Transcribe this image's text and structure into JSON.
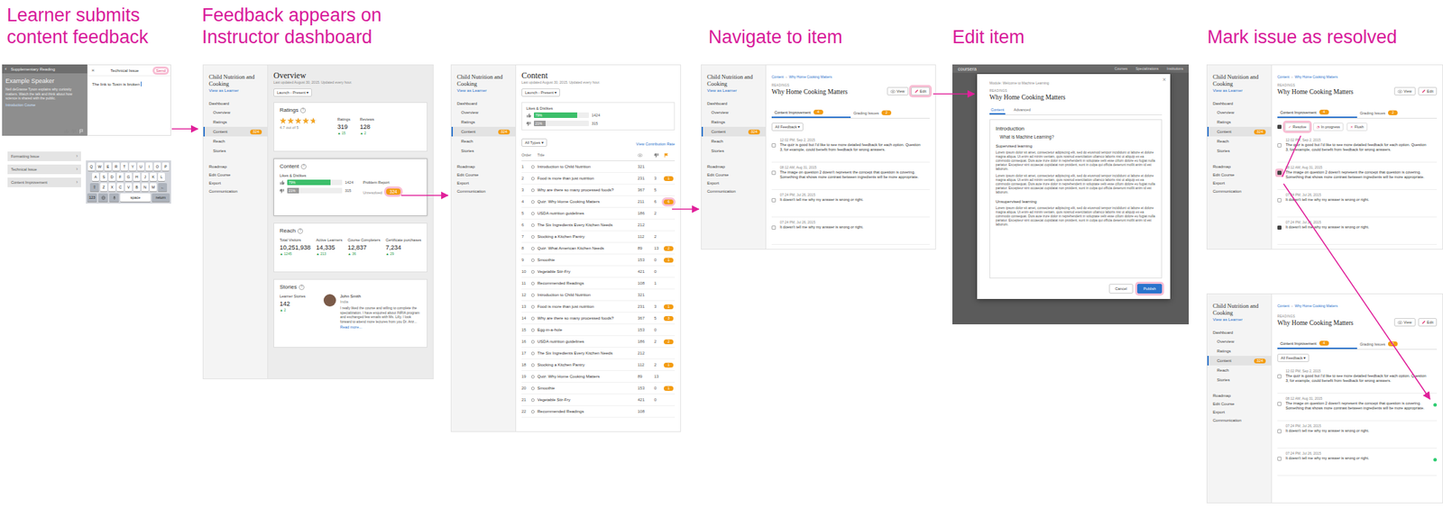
{
  "stepTitles": [
    "Learner submits content feedback",
    "Feedback appears on Instructor dashboard",
    "Navigate to item",
    "Edit item",
    "Mark issue as resolved"
  ],
  "mobile": {
    "reading": {
      "back": "‹",
      "title": "Supplementary Reading",
      "heading": "Example Speaker",
      "body": "Neil deGrasse Tyson explains why curiosity matters. Watch the talk and think about how science is shared with the public.",
      "link": "Introduction Course"
    },
    "report": {
      "close": "×",
      "title": "Technical Issue",
      "send": "Send",
      "sendHighlighted": true,
      "text": "The link to Tosin is broken"
    },
    "issueTypes": [
      {
        "label": "Formatting Issue",
        "chevron": "›"
      },
      {
        "label": "Technical Issue",
        "chevron": "›"
      },
      {
        "label": "Content Improvement",
        "chevron": "›"
      }
    ],
    "keyboard": {
      "rows": [
        [
          "Q",
          "W",
          "E",
          "R",
          "T",
          "Y",
          "U",
          "I",
          "O",
          "P"
        ],
        [
          "A",
          "S",
          "D",
          "F",
          "G",
          "H",
          "J",
          "K",
          "L"
        ],
        [
          "⇧",
          "Z",
          "X",
          "C",
          "V",
          "B",
          "N",
          "M",
          "←"
        ]
      ],
      "bottom": [
        "123",
        "space",
        "return"
      ]
    }
  },
  "sidebar": {
    "course": "Child Nutrition and Cooking",
    "viewAs": "View as Learner",
    "heading": "Dashboard",
    "items": [
      {
        "label": "Overview",
        "badge": "",
        "selected": false
      },
      {
        "label": "Ratings",
        "badge": "",
        "selected": false
      },
      {
        "label": "Content",
        "badge": "324",
        "selected": true
      },
      {
        "label": "Reach",
        "badge": "",
        "selected": false
      },
      {
        "label": "Stories",
        "badge": "",
        "selected": false
      }
    ],
    "links": [
      "Roadmap",
      "Edit Course",
      "Export",
      "Communication"
    ]
  },
  "overview": {
    "title": "Overview",
    "updated": "Last updated August 30, 2015. Updated every hour.",
    "range": "Launch - Present ▾",
    "help": "?",
    "ratings": {
      "title": "Ratings",
      "stars": 4.7,
      "caption": "4.7 out of 5",
      "stats": [
        {
          "label": "Ratings",
          "value": "319",
          "delta": "▲ 15"
        },
        {
          "label": "Reviews",
          "value": "128",
          "delta": "▲ 2"
        }
      ]
    },
    "content": {
      "title": "Content",
      "likesTitle": "Likes & Dislikes",
      "bars": [
        {
          "kind": "like",
          "pct": "79%",
          "level": 0.79,
          "count": "1424",
          "color": "#3cbf6a"
        },
        {
          "kind": "dislike",
          "pct": "21%",
          "level": 0.21,
          "count": "315",
          "color": "#9a9a9a"
        }
      ],
      "problemTitle": "Problem Report",
      "unresolvedLabel": "Unresolved",
      "unresolved": "324",
      "unresolvedHighlighted": true
    },
    "reach": {
      "title": "Reach",
      "stats": [
        {
          "label": "Total Visitors",
          "value": "10,251,938",
          "delta": "▲ 1245"
        },
        {
          "label": "Active Learners",
          "value": "14,335",
          "delta": "▲ 213"
        },
        {
          "label": "Course Completers",
          "value": "12,837",
          "delta": "▲ 36"
        },
        {
          "label": "Certificate purchases",
          "value": "7,234",
          "delta": "▲ 29"
        }
      ]
    },
    "stories": {
      "title": "Stories",
      "label": "Learner Stories",
      "count": "142",
      "delta": "▲ 2",
      "name": "John Smith",
      "country": "India",
      "quote": "I really liked the course and willing to complete the specialization. I have enquired about INRIA program and exchanged few emails with Ms. Lilly. I look forward to attend more lectures from you Dr. Ariz...",
      "more": "Read more..."
    }
  },
  "contentPage": {
    "title": "Content",
    "filter": "All Types ▾",
    "contributionLink": "View Contribution Rate",
    "columns": [
      "Order",
      "Title"
    ],
    "rows": [
      {
        "order": "1",
        "title": "Introduction to Child Nutrition",
        "views": "321",
        "count": "",
        "issues": "",
        "highlighted": false
      },
      {
        "order": "2",
        "title": "Food is more than just nutrition",
        "views": "231",
        "count": "3",
        "issues": "1",
        "highlighted": false
      },
      {
        "order": "3",
        "title": "Why are there so many processed foods?",
        "views": "367",
        "count": "5",
        "issues": "",
        "highlighted": false
      },
      {
        "order": "4",
        "title": "Quiz: Why Home Cooking Matters",
        "views": "211",
        "count": "6",
        "issues": "6",
        "highlighted": true
      },
      {
        "order": "5",
        "title": "USDA nutrition guidelines",
        "views": "186",
        "count": "2",
        "issues": "",
        "highlighted": false
      },
      {
        "order": "6",
        "title": "The Six Ingredients Every Kitchen Needs",
        "views": "212",
        "count": "",
        "issues": "",
        "highlighted": false
      },
      {
        "order": "7",
        "title": "Stocking a Kitchen Pantry",
        "views": "112",
        "count": "2",
        "issues": "",
        "highlighted": false
      },
      {
        "order": "8",
        "title": "Quiz: What American Kitchen Needs",
        "views": "89",
        "count": "13",
        "issues": "2",
        "highlighted": false
      },
      {
        "order": "9",
        "title": "Smoothie",
        "views": "153",
        "count": "0",
        "issues": "1",
        "highlighted": false
      },
      {
        "order": "10",
        "title": "Vegetable Stir-Fry",
        "views": "421",
        "count": "0",
        "issues": "",
        "highlighted": false
      },
      {
        "order": "11",
        "title": "Recommended Readings",
        "views": "108",
        "count": "1",
        "issues": "",
        "highlighted": false
      },
      {
        "order": "12",
        "title": "Introduction to Child Nutrition",
        "views": "321",
        "count": "",
        "issues": "",
        "highlighted": false
      },
      {
        "order": "13",
        "title": "Food is more than just nutrition",
        "views": "231",
        "count": "3",
        "issues": "1",
        "highlighted": false
      },
      {
        "order": "14",
        "title": "Why are there so many processed foods?",
        "views": "367",
        "count": "5",
        "issues": "3",
        "highlighted": false
      },
      {
        "order": "15",
        "title": "Egg-in-a-hole",
        "views": "153",
        "count": "0",
        "issues": "",
        "highlighted": false
      },
      {
        "order": "16",
        "title": "USDA nutrition guidelines",
        "views": "186",
        "count": "2",
        "issues": "2",
        "highlighted": false
      },
      {
        "order": "17",
        "title": "The Six Ingredients Every Kitchen Needs",
        "views": "212",
        "count": "",
        "issues": "",
        "highlighted": false
      },
      {
        "order": "18",
        "title": "Stocking a Kitchen Pantry",
        "views": "112",
        "count": "2",
        "issues": "1",
        "highlighted": false
      },
      {
        "order": "19",
        "title": "Quiz: Why Home Cooking Matters",
        "views": "89",
        "count": "13",
        "issues": "",
        "highlighted": false
      },
      {
        "order": "20",
        "title": "Smoothie",
        "views": "153",
        "count": "0",
        "issues": "1",
        "highlighted": false
      },
      {
        "order": "21",
        "title": "Vegetable Stir-Fry",
        "views": "421",
        "count": "0",
        "issues": "",
        "highlighted": false
      },
      {
        "order": "22",
        "title": "Recommended Readings",
        "views": "108",
        "count": "",
        "issues": "",
        "highlighted": false
      }
    ]
  },
  "item": {
    "breadcrumb": [
      "Content",
      "Why Home Cooking Matters"
    ],
    "breadcrumbSep": "›",
    "kind": "READINGS",
    "title": "Why Home Cooking Matters",
    "viewLabel": "View",
    "editLabel": "Edit",
    "tabs": [
      {
        "label": "Content Improvement",
        "badge": "4",
        "selected": true
      },
      {
        "label": "Grading Issues",
        "badge": "2",
        "selected": false
      }
    ],
    "filter": "All Feedback ▾",
    "actions": [
      {
        "icon": "✓",
        "label": "Resolve",
        "highlighted": true
      },
      {
        "icon": "◔",
        "label": "In progress",
        "highlighted": false
      },
      {
        "icon": "✕",
        "label": "Flush",
        "highlighted": false
      }
    ],
    "feedback": [
      {
        "time": "12:02 PM, Sep 2, 2015",
        "text": "The quiz is good but I'd like to see more detailed feedback for each option. Question 3, for example, could benefit from feedback for wrong answers."
      },
      {
        "time": "08:12 AM, Aug 31, 2015",
        "text": "The image on question 2 doesn't represent the concept that question is covering. Something that shows more contrast between ingredients will be more appropriate."
      },
      {
        "time": "07:24 PM, Jul 26, 2015",
        "text": "It doesn't tell me why my answer is wrong or right."
      },
      {
        "time": "07:24 PM, Jul 26, 2015",
        "text": "It doesn't tell me why my answer is wrong or right."
      }
    ]
  },
  "views": {
    "navigate": {
      "editHighlighted": true,
      "actionsVisible": false,
      "selectAllChecked": false,
      "feedbackStates": [
        {
          "checked": false,
          "resolved": false,
          "highlighted": false
        },
        {
          "checked": false,
          "resolved": false,
          "highlighted": false
        },
        {
          "checked": false,
          "resolved": false,
          "highlighted": false
        },
        {
          "checked": false,
          "resolved": false,
          "highlighted": false
        }
      ]
    },
    "resolveTop": {
      "editHighlighted": false,
      "actionsVisible": true,
      "selectAllChecked": true,
      "feedbackStates": [
        {
          "checked": false,
          "resolved": false,
          "highlighted": false
        },
        {
          "checked": true,
          "resolved": false,
          "highlighted": true
        },
        {
          "checked": false,
          "resolved": false,
          "highlighted": false
        },
        {
          "checked": true,
          "resolved": false,
          "highlighted": false
        }
      ]
    },
    "resolveBottom": {
      "editHighlighted": false,
      "actionsVisible": false,
      "selectAllChecked": false,
      "feedbackStates": [
        {
          "checked": false,
          "resolved": false,
          "highlighted": false
        },
        {
          "checked": false,
          "resolved": true,
          "highlighted": false
        },
        {
          "checked": false,
          "resolved": false,
          "highlighted": false
        },
        {
          "checked": false,
          "resolved": true,
          "highlighted": false
        }
      ]
    }
  },
  "editor": {
    "backdropLogo": "coursera",
    "backdropNav": [
      "Courses",
      "Specializations",
      "Institutions"
    ],
    "close": "×",
    "module": "Module: Welcome to Machine Learning",
    "kind": "READINGS",
    "title": "Why Home Cooking Matters",
    "tabs": [
      {
        "label": "Content",
        "selected": true
      },
      {
        "label": "Advanced",
        "selected": false
      }
    ],
    "blocks": [
      {
        "kind": "h1",
        "text": "Introduction"
      },
      {
        "kind": "h2",
        "text": "What is Machine Learning?"
      },
      {
        "kind": "h3",
        "text": "Supervised learning"
      },
      {
        "kind": "p",
        "text": "Lorem ipsum dolor sit amet, consectetur adipiscing elit, sed do eiusmod tempor incididunt ut labore et dolore magna aliqua. Ut enim ad minim veniam, quis nostrud exercitation ullamco laboris nisi ut aliquip ex ea commodo consequat. Duis aute irure dolor in reprehenderit in voluptate velit esse cillum dolore eu fugiat nulla pariatur. Excepteur sint occaecat cupidatat non proident, sunt in culpa qui officia deserunt mollit anim id est laborum."
      },
      {
        "kind": "p",
        "text": "Lorem ipsum dolor sit amet, consectetur adipiscing elit, sed do eiusmod tempor incididunt ut labore et dolore magna aliqua. Ut enim ad minim veniam, quis nostrud exercitation ullamco laboris nisi ut aliquip ex ea commodo consequat. Duis aute irure dolor in reprehenderit in voluptate velit esse cillum dolore eu fugiat nulla pariatur. Excepteur sint occaecat cupidatat non proident, sunt in culpa qui officia deserunt mollit anim id est laborum."
      },
      {
        "kind": "h3",
        "text": "Unsupervised learning"
      },
      {
        "kind": "p",
        "text": "Lorem ipsum dolor sit amet, consectetur adipiscing elit, sed do eiusmod tempor incididunt ut labore et dolore magna aliqua. Ut enim ad minim veniam, quis nostrud exercitation ullamco laboris nisi ut aliquip ex ea commodo consequat. Duis aute irure dolor in reprehenderit in voluptate velit esse cillum dolore eu fugiat nulla pariatur. Excepteur sint occaecat cupidatat non proident, sunt in culpa qui officia deserunt mollit anim id est laborum."
      }
    ],
    "cancel": "Cancel",
    "publish": "Publish",
    "publishHighlighted": true
  }
}
